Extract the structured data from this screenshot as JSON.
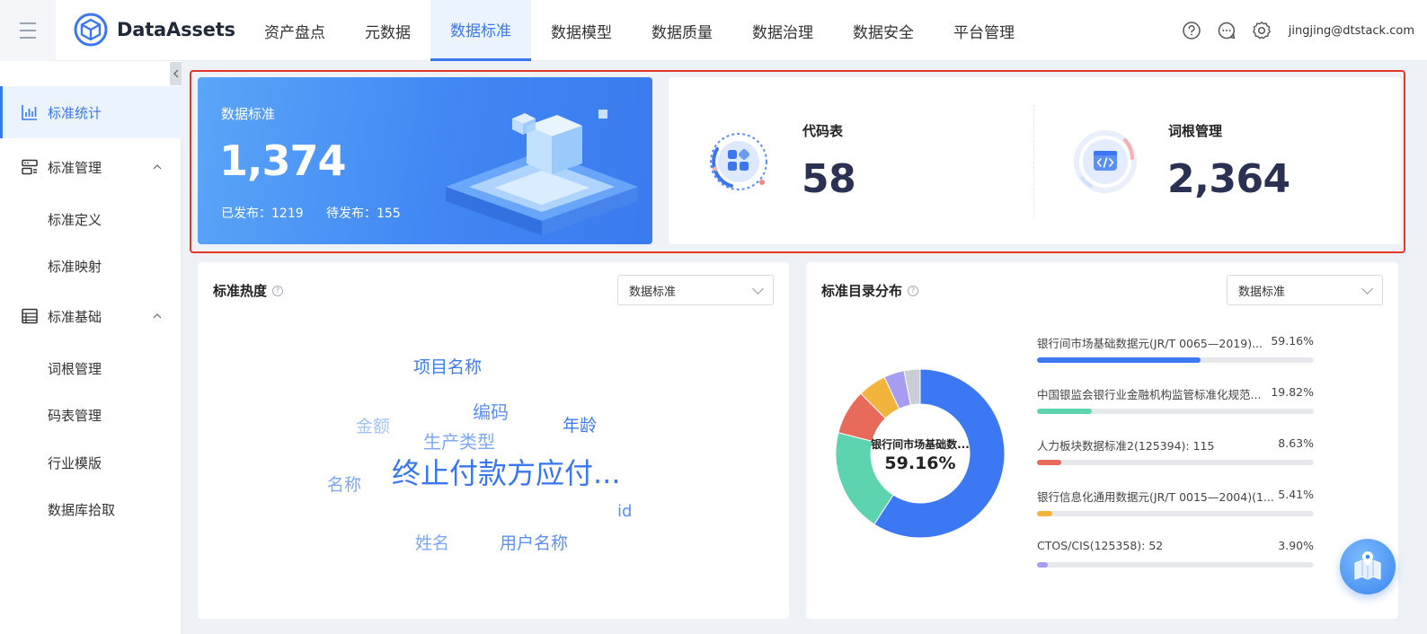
{
  "app": {
    "name": "DataAssets"
  },
  "nav": {
    "items": [
      {
        "label": "资产盘点"
      },
      {
        "label": "元数据"
      },
      {
        "label": "数据标准"
      },
      {
        "label": "数据模型"
      },
      {
        "label": "数据质量"
      },
      {
        "label": "数据治理"
      },
      {
        "label": "数据安全"
      },
      {
        "label": "平台管理"
      }
    ],
    "active": "数据标准"
  },
  "user": {
    "email": "jingjing@dtstack.com"
  },
  "sidebar": {
    "items": [
      {
        "label": "标准统计",
        "icon": "bar-chart-icon"
      },
      {
        "label": "标准管理",
        "icon": "server-icon"
      },
      {
        "label": "标准基础",
        "icon": "list-icon"
      }
    ],
    "management_children": [
      "标准定义",
      "标准映射"
    ],
    "basics_children": [
      "词根管理",
      "码表管理",
      "行业模版",
      "数据库拾取"
    ]
  },
  "summary": {
    "title": "数据标准",
    "total": "1,374",
    "published_label": "已发布：1219",
    "pending_label": "待发布：155"
  },
  "stats": [
    {
      "title": "代码表",
      "value": "58",
      "icon": "code-table-icon"
    },
    {
      "title": "词根管理",
      "value": "2,364",
      "icon": "word-root-icon"
    }
  ],
  "heat_panel": {
    "title": "标准热度",
    "help": "?",
    "select_value": "数据标准",
    "words": [
      {
        "text": "项目名称"
      },
      {
        "text": "编码"
      },
      {
        "text": "金额"
      },
      {
        "text": "年龄"
      },
      {
        "text": "生产类型"
      },
      {
        "text": "终止付款方应付..."
      },
      {
        "text": "名称"
      },
      {
        "text": "id"
      },
      {
        "text": "姓名"
      },
      {
        "text": "用户名称"
      }
    ]
  },
  "dist_panel": {
    "title": "标准目录分布",
    "help": "?",
    "select_value": "数据标准",
    "center_label": "银行间市场基础数...",
    "center_value": "59.16%"
  },
  "colors": {
    "primary": "#3a76f0",
    "donut": [
      "#3b78f2",
      "#5ed3b0",
      "#e86a5a",
      "#f2b43c",
      "#a69cf0",
      "#c8cdd6"
    ]
  },
  "chart_data": {
    "type": "pie",
    "series": [
      {
        "name": "银行间市场基础数据元(JR/T 0065—2019)...",
        "pct_label": "59.16%",
        "value": 59.16
      },
      {
        "name": "中国银监会银行业金融机构监管标准化规范...",
        "pct_label": "19.82%",
        "value": 19.82
      },
      {
        "name": "人力板块数据标准2(125394): 115",
        "pct_label": "8.63%",
        "value": 8.63
      },
      {
        "name": "银行信息化通用数据元(JR/T 0015—2004)(1...",
        "pct_label": "5.41%",
        "value": 5.41
      },
      {
        "name": "CTOS/CIS(125358): 52",
        "pct_label": "3.90%",
        "value": 3.9
      },
      {
        "value": 3.08
      }
    ]
  }
}
